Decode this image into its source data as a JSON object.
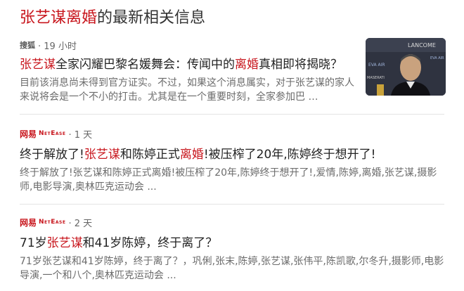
{
  "header": {
    "topic": "张艺谋离婚",
    "suffix": "的最新相关信息"
  },
  "results": [
    {
      "source_logo_text": "搜狐",
      "time": "· 19 小时",
      "title_parts": [
        "张艺谋",
        "全家闪耀巴黎名媛舞会：传闻中的",
        "离婚",
        "真相即将揭晓？"
      ],
      "snippet": "目前该消息尚未得到官方证实。不过，如果这个消息属实，对于张艺谋的家人来说将会是一个不小的打击。尤其是在一个重要时刻，全家参加巴 …"
    },
    {
      "source_logo_cn": "网易",
      "source_logo_en": "NetEase",
      "time": "· 1 天",
      "title_parts": [
        "终于解放了!",
        "张艺谋",
        "和陈婷正式",
        "离婚",
        "!被压榨了20年,陈婷终于想开了!"
      ],
      "snippet": "终于解放了!张艺谋和陈婷正式离婚!被压榨了20年,陈婷终于想开了!,爱情,陈婷,离婚,张艺谋,摄影师,电影导演,奥林匹克运动会 ..."
    },
    {
      "source_logo_cn": "网易",
      "source_logo_en": "NetEase",
      "time": "· 2 天",
      "title_parts": [
        "71岁",
        "张艺谋",
        "和41岁陈婷，终于离了？"
      ],
      "snippet": "71岁张艺谋和41岁陈婷，终于离了？，巩俐,张末,陈婷,张艺谋,张伟平,陈凯歌,尔冬升,摄影师,电影导演,一个和八个,奥林匹克运动会 ..."
    }
  ],
  "thumbnail": {
    "banner_texts": [
      "LANCOME",
      "EVA AIR",
      "MASERATI",
      "EVA AIR"
    ]
  },
  "colors": {
    "highlight": "#c8161d",
    "snippet": "#6b6b6b"
  }
}
